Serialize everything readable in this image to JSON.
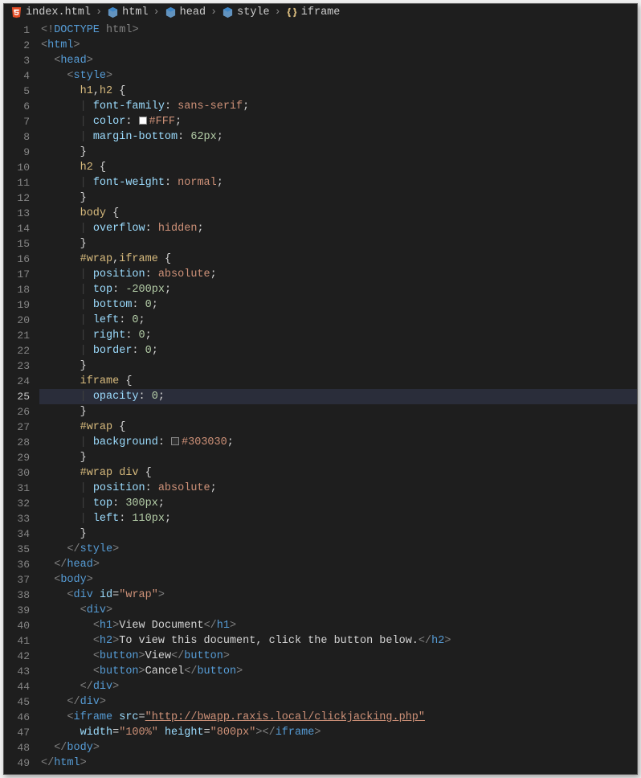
{
  "breadcrumb": {
    "items": [
      {
        "icon": "html5-file-icon",
        "label": "index.html"
      },
      {
        "icon": "symbol-cube-icon",
        "label": "html"
      },
      {
        "icon": "symbol-cube-icon",
        "label": "head"
      },
      {
        "icon": "symbol-cube-icon",
        "label": "style"
      },
      {
        "icon": "symbol-brace-icon",
        "label": "iframe"
      }
    ],
    "separator": "›"
  },
  "highlighted_line": 25,
  "code": [
    {
      "n": 1,
      "i": 0,
      "t": [
        [
          "p",
          "<!"
        ],
        [
          "tg",
          "DOCTYPE"
        ],
        [
          "dt",
          " html"
        ],
        [
          "p",
          ">"
        ]
      ]
    },
    {
      "n": 2,
      "i": 0,
      "t": [
        [
          "p",
          "<"
        ],
        [
          "tg",
          "html"
        ],
        [
          "p",
          ">"
        ]
      ]
    },
    {
      "n": 3,
      "i": 1,
      "t": [
        [
          "p",
          "<"
        ],
        [
          "tg",
          "head"
        ],
        [
          "p",
          ">"
        ]
      ]
    },
    {
      "n": 4,
      "i": 2,
      "t": [
        [
          "p",
          "<"
        ],
        [
          "tg",
          "style"
        ],
        [
          "p",
          ">"
        ]
      ]
    },
    {
      "n": 5,
      "i": 3,
      "t": [
        [
          "sel",
          "h1"
        ],
        [
          "txt",
          ","
        ],
        [
          "sel",
          "h2"
        ],
        [
          "txt",
          " {"
        ]
      ]
    },
    {
      "n": 6,
      "i": 3,
      "t": [
        [
          "guide",
          "| "
        ],
        [
          "prop",
          "font-family"
        ],
        [
          "txt",
          ": "
        ],
        [
          "val",
          "sans-serif"
        ],
        [
          "txt",
          ";"
        ]
      ]
    },
    {
      "n": 7,
      "i": 3,
      "t": [
        [
          "guide",
          "| "
        ],
        [
          "prop",
          "color"
        ],
        [
          "txt",
          ": "
        ],
        [
          "swatch",
          "#FFFFFF"
        ],
        [
          "val",
          "#FFF"
        ],
        [
          "txt",
          ";"
        ]
      ]
    },
    {
      "n": 8,
      "i": 3,
      "t": [
        [
          "guide",
          "| "
        ],
        [
          "prop",
          "margin-bottom"
        ],
        [
          "txt",
          ": "
        ],
        [
          "num",
          "62px"
        ],
        [
          "txt",
          ";"
        ]
      ]
    },
    {
      "n": 9,
      "i": 3,
      "t": [
        [
          "txt",
          "}"
        ]
      ]
    },
    {
      "n": 10,
      "i": 3,
      "t": [
        [
          "sel",
          "h2"
        ],
        [
          "txt",
          " {"
        ]
      ]
    },
    {
      "n": 11,
      "i": 3,
      "t": [
        [
          "guide",
          "| "
        ],
        [
          "prop",
          "font-weight"
        ],
        [
          "txt",
          ": "
        ],
        [
          "val",
          "normal"
        ],
        [
          "txt",
          ";"
        ]
      ]
    },
    {
      "n": 12,
      "i": 3,
      "t": [
        [
          "txt",
          "}"
        ]
      ]
    },
    {
      "n": 13,
      "i": 3,
      "t": [
        [
          "sel",
          "body"
        ],
        [
          "txt",
          " {"
        ]
      ]
    },
    {
      "n": 14,
      "i": 3,
      "t": [
        [
          "guide",
          "| "
        ],
        [
          "prop",
          "overflow"
        ],
        [
          "txt",
          ": "
        ],
        [
          "val",
          "hidden"
        ],
        [
          "txt",
          ";"
        ]
      ]
    },
    {
      "n": 15,
      "i": 3,
      "t": [
        [
          "txt",
          "}"
        ]
      ]
    },
    {
      "n": 16,
      "i": 3,
      "t": [
        [
          "sel",
          "#wrap"
        ],
        [
          "txt",
          ","
        ],
        [
          "sel",
          "iframe"
        ],
        [
          "txt",
          " {"
        ]
      ]
    },
    {
      "n": 17,
      "i": 3,
      "t": [
        [
          "guide",
          "| "
        ],
        [
          "prop",
          "position"
        ],
        [
          "txt",
          ": "
        ],
        [
          "val",
          "absolute"
        ],
        [
          "txt",
          ";"
        ]
      ]
    },
    {
      "n": 18,
      "i": 3,
      "t": [
        [
          "guide",
          "| "
        ],
        [
          "prop",
          "top"
        ],
        [
          "txt",
          ": "
        ],
        [
          "num",
          "-200px"
        ],
        [
          "txt",
          ";"
        ]
      ]
    },
    {
      "n": 19,
      "i": 3,
      "t": [
        [
          "guide",
          "| "
        ],
        [
          "prop",
          "bottom"
        ],
        [
          "txt",
          ": "
        ],
        [
          "num",
          "0"
        ],
        [
          "txt",
          ";"
        ]
      ]
    },
    {
      "n": 20,
      "i": 3,
      "t": [
        [
          "guide",
          "| "
        ],
        [
          "prop",
          "left"
        ],
        [
          "txt",
          ": "
        ],
        [
          "num",
          "0"
        ],
        [
          "txt",
          ";"
        ]
      ]
    },
    {
      "n": 21,
      "i": 3,
      "t": [
        [
          "guide",
          "| "
        ],
        [
          "prop",
          "right"
        ],
        [
          "txt",
          ": "
        ],
        [
          "num",
          "0"
        ],
        [
          "txt",
          ";"
        ]
      ]
    },
    {
      "n": 22,
      "i": 3,
      "t": [
        [
          "guide",
          "| "
        ],
        [
          "prop",
          "border"
        ],
        [
          "txt",
          ": "
        ],
        [
          "num",
          "0"
        ],
        [
          "txt",
          ";"
        ]
      ]
    },
    {
      "n": 23,
      "i": 3,
      "t": [
        [
          "txt",
          "}"
        ]
      ]
    },
    {
      "n": 24,
      "i": 3,
      "t": [
        [
          "sel",
          "iframe"
        ],
        [
          "txt",
          " {"
        ]
      ]
    },
    {
      "n": 25,
      "i": 3,
      "t": [
        [
          "guide",
          "| "
        ],
        [
          "prop",
          "opacity"
        ],
        [
          "txt",
          ": "
        ],
        [
          "num",
          "0"
        ],
        [
          "txt",
          ";"
        ]
      ]
    },
    {
      "n": 26,
      "i": 3,
      "t": [
        [
          "txt",
          "}"
        ]
      ]
    },
    {
      "n": 27,
      "i": 3,
      "t": [
        [
          "sel",
          "#wrap"
        ],
        [
          "txt",
          " {"
        ]
      ]
    },
    {
      "n": 28,
      "i": 3,
      "t": [
        [
          "guide",
          "| "
        ],
        [
          "prop",
          "background"
        ],
        [
          "txt",
          ": "
        ],
        [
          "swatch",
          "#303030"
        ],
        [
          "val",
          "#303030"
        ],
        [
          "txt",
          ";"
        ]
      ]
    },
    {
      "n": 29,
      "i": 3,
      "t": [
        [
          "txt",
          "}"
        ]
      ]
    },
    {
      "n": 30,
      "i": 3,
      "t": [
        [
          "sel",
          "#wrap div"
        ],
        [
          "txt",
          " {"
        ]
      ]
    },
    {
      "n": 31,
      "i": 3,
      "t": [
        [
          "guide",
          "| "
        ],
        [
          "prop",
          "position"
        ],
        [
          "txt",
          ": "
        ],
        [
          "val",
          "absolute"
        ],
        [
          "txt",
          ";"
        ]
      ]
    },
    {
      "n": 32,
      "i": 3,
      "t": [
        [
          "guide",
          "| "
        ],
        [
          "prop",
          "top"
        ],
        [
          "txt",
          ": "
        ],
        [
          "num",
          "300px"
        ],
        [
          "txt",
          ";"
        ]
      ]
    },
    {
      "n": 33,
      "i": 3,
      "t": [
        [
          "guide",
          "| "
        ],
        [
          "prop",
          "left"
        ],
        [
          "txt",
          ": "
        ],
        [
          "num",
          "110px"
        ],
        [
          "txt",
          ";"
        ]
      ]
    },
    {
      "n": 34,
      "i": 3,
      "t": [
        [
          "txt",
          "}"
        ]
      ]
    },
    {
      "n": 35,
      "i": 2,
      "t": [
        [
          "p",
          "</"
        ],
        [
          "tg",
          "style"
        ],
        [
          "p",
          ">"
        ]
      ]
    },
    {
      "n": 36,
      "i": 1,
      "t": [
        [
          "p",
          "</"
        ],
        [
          "tg",
          "head"
        ],
        [
          "p",
          ">"
        ]
      ]
    },
    {
      "n": 37,
      "i": 1,
      "t": [
        [
          "p",
          "<"
        ],
        [
          "tg",
          "body"
        ],
        [
          "p",
          ">"
        ]
      ]
    },
    {
      "n": 38,
      "i": 2,
      "t": [
        [
          "p",
          "<"
        ],
        [
          "tg",
          "div"
        ],
        [
          "txt",
          " "
        ],
        [
          "attr",
          "id"
        ],
        [
          "txt",
          "="
        ],
        [
          "val",
          "\"wrap\""
        ],
        [
          "p",
          ">"
        ]
      ]
    },
    {
      "n": 39,
      "i": 3,
      "t": [
        [
          "p",
          "<"
        ],
        [
          "tg",
          "div"
        ],
        [
          "p",
          ">"
        ]
      ]
    },
    {
      "n": 40,
      "i": 4,
      "t": [
        [
          "p",
          "<"
        ],
        [
          "tg",
          "h1"
        ],
        [
          "p",
          ">"
        ],
        [
          "txt",
          "View Document"
        ],
        [
          "p",
          "</"
        ],
        [
          "tg",
          "h1"
        ],
        [
          "p",
          ">"
        ]
      ]
    },
    {
      "n": 41,
      "i": 4,
      "t": [
        [
          "p",
          "<"
        ],
        [
          "tg",
          "h2"
        ],
        [
          "p",
          ">"
        ],
        [
          "txt",
          "To view this document, click the button below."
        ],
        [
          "p",
          "</"
        ],
        [
          "tg",
          "h2"
        ],
        [
          "p",
          ">"
        ]
      ]
    },
    {
      "n": 42,
      "i": 4,
      "t": [
        [
          "p",
          "<"
        ],
        [
          "tg",
          "button"
        ],
        [
          "p",
          ">"
        ],
        [
          "txt",
          "View"
        ],
        [
          "p",
          "</"
        ],
        [
          "tg",
          "button"
        ],
        [
          "p",
          ">"
        ]
      ]
    },
    {
      "n": 43,
      "i": 4,
      "t": [
        [
          "p",
          "<"
        ],
        [
          "tg",
          "button"
        ],
        [
          "p",
          ">"
        ],
        [
          "txt",
          "Cancel"
        ],
        [
          "p",
          "</"
        ],
        [
          "tg",
          "button"
        ],
        [
          "p",
          ">"
        ]
      ]
    },
    {
      "n": 44,
      "i": 3,
      "t": [
        [
          "p",
          "</"
        ],
        [
          "tg",
          "div"
        ],
        [
          "p",
          ">"
        ]
      ]
    },
    {
      "n": 45,
      "i": 2,
      "t": [
        [
          "p",
          "</"
        ],
        [
          "tg",
          "div"
        ],
        [
          "p",
          ">"
        ]
      ]
    },
    {
      "n": 46,
      "i": 2,
      "t": [
        [
          "p",
          "<"
        ],
        [
          "tg",
          "iframe"
        ],
        [
          "txt",
          " "
        ],
        [
          "attr",
          "src"
        ],
        [
          "txt",
          "="
        ],
        [
          "url",
          "\"http://bwapp.raxis.local/clickjacking.php\""
        ]
      ]
    },
    {
      "n": 47,
      "i": 3,
      "t": [
        [
          "attr",
          "width"
        ],
        [
          "txt",
          "="
        ],
        [
          "val",
          "\"100%\""
        ],
        [
          "txt",
          " "
        ],
        [
          "attr",
          "height"
        ],
        [
          "txt",
          "="
        ],
        [
          "val",
          "\"800px\""
        ],
        [
          "p",
          "></"
        ],
        [
          "tg",
          "iframe"
        ],
        [
          "p",
          ">"
        ]
      ]
    },
    {
      "n": 48,
      "i": 1,
      "t": [
        [
          "p",
          "</"
        ],
        [
          "tg",
          "body"
        ],
        [
          "p",
          ">"
        ]
      ]
    },
    {
      "n": 49,
      "i": 0,
      "t": [
        [
          "p",
          "</"
        ],
        [
          "tg",
          "html"
        ],
        [
          "p",
          ">"
        ]
      ]
    }
  ]
}
